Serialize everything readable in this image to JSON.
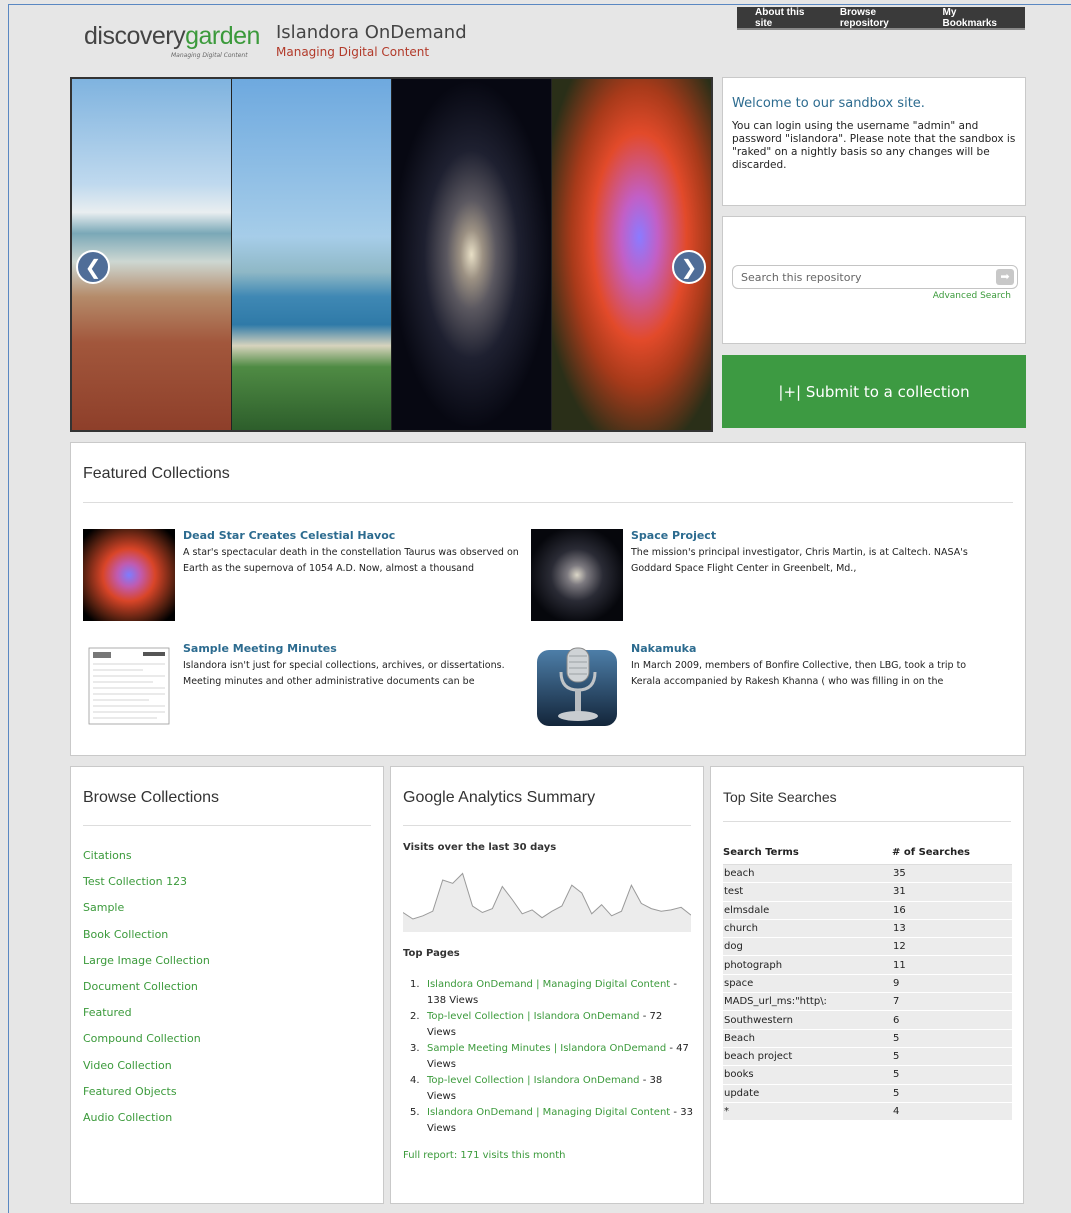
{
  "header": {
    "logo_word1": "discovery",
    "logo_word2": "garden",
    "logo_tagline": "Managing Digital Content",
    "site_title": "Islandora OnDemand",
    "site_slogan": "Managing Digital Content"
  },
  "topnav": [
    "About this site",
    "Browse repository",
    "My Bookmarks"
  ],
  "slider": {
    "prev_glyph": "❮",
    "next_glyph": "❯"
  },
  "welcome": {
    "title": "Welcome to our sandbox site.",
    "body": "You can login using the username \"admin\" and password \"islandora\". Please note that the sandbox is \"raked\" on a nightly basis so any changes will be discarded."
  },
  "search": {
    "placeholder": "Search this repository",
    "advanced": "Advanced Search",
    "go_glyph": "➡"
  },
  "submit": {
    "label": "|+| Submit to a collection"
  },
  "featured": {
    "title": "Featured Collections",
    "items": [
      {
        "title": "Dead Star Creates Celestial Havoc",
        "desc": "A star's spectacular death in the constellation Taurus was observed on Earth as the supernova of 1054 A.D. Now, almost a thousand"
      },
      {
        "title": "Space Project",
        "desc": "The mission's principal investigator, Chris Martin, is at Caltech. NASA's Goddard Space Flight Center in Greenbelt, Md.,"
      },
      {
        "title": "Sample Meeting Minutes",
        "desc": "Islandora isn't just for special collections, archives, or dissertations. Meeting minutes and other administrative documents can be"
      },
      {
        "title": "Nakamuka",
        "desc": "In March 2009, members of Bonfire Collective, then LBG, took a trip to Kerala accompanied by Rakesh Khanna ( who was filling in on the"
      }
    ]
  },
  "browse": {
    "title": "Browse Collections",
    "items": [
      "Citations",
      "Test Collection 123",
      "Sample",
      "Book Collection",
      "Large Image Collection",
      "Document Collection",
      "Featured",
      "Compound Collection",
      "Video Collection",
      "Featured Objects",
      "Audio Collection"
    ]
  },
  "analytics": {
    "title": "Google Analytics Summary",
    "subtitle": "Visits over the last 30 days",
    "top_pages_label": "Top Pages",
    "pages": [
      {
        "num": "1.",
        "link": "Islandora OnDemand | Managing Digital Content",
        "count": " - 138 Views"
      },
      {
        "num": "2.",
        "link": "Top-level Collection | Islandora OnDemand",
        "count": " - 72 Views"
      },
      {
        "num": "3.",
        "link": "Sample Meeting Minutes | Islandora OnDemand",
        "count": " - 47 Views"
      },
      {
        "num": "4.",
        "link": "Top-level Collection | Islandora OnDemand",
        "count": " - 38 Views"
      },
      {
        "num": "5.",
        "link": "Islandora OnDemand | Managing Digital Content",
        "count": " - 33 Views"
      }
    ],
    "full_report": "Full report: 171 visits this month",
    "chart_data": {
      "type": "area",
      "values": [
        3,
        2,
        2.5,
        3.2,
        8,
        7.5,
        9,
        4,
        3,
        3.6,
        7,
        5,
        2.8,
        3.4,
        2.2,
        3.2,
        4,
        7.2,
        6,
        2.8,
        4.2,
        2.5,
        3.2,
        7.2,
        4.4,
        3.6,
        3.2,
        3.4,
        3.8,
        2.6
      ],
      "ylim": [
        0,
        10
      ]
    }
  },
  "top_searches": {
    "title": "Top Site Searches",
    "col1": "Search Terms",
    "col2": "# of Searches",
    "rows": [
      [
        "beach",
        "35"
      ],
      [
        "test",
        "31"
      ],
      [
        "elmsdale",
        "16"
      ],
      [
        "church",
        "13"
      ],
      [
        "dog",
        "12"
      ],
      [
        "photograph",
        "11"
      ],
      [
        "space",
        "9"
      ],
      [
        "MADS_url_ms:\"http\\:",
        "7"
      ],
      [
        "Southwestern",
        "6"
      ],
      [
        "Beach",
        "5"
      ],
      [
        "beach project",
        "5"
      ],
      [
        "books",
        "5"
      ],
      [
        "update",
        "5"
      ],
      [
        "*",
        "4"
      ]
    ]
  }
}
